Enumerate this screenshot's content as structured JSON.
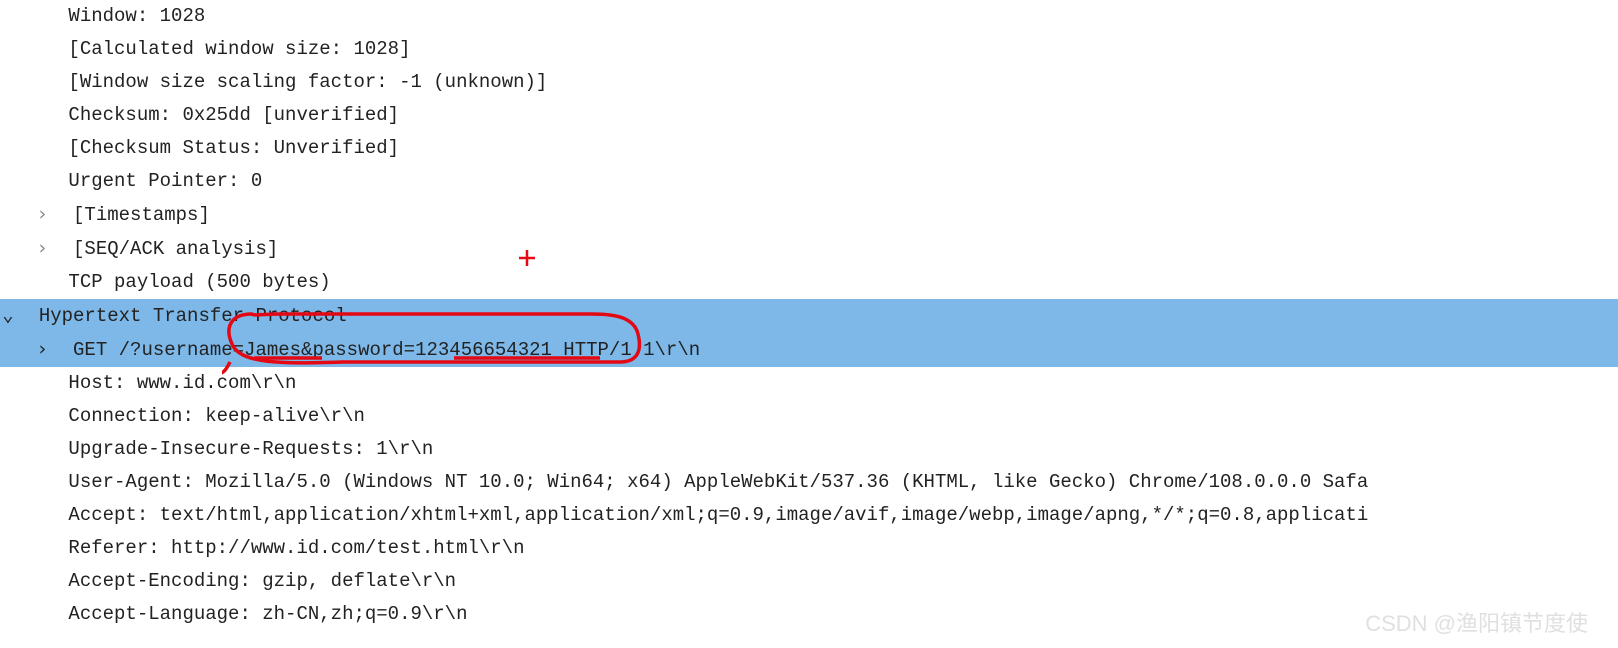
{
  "tcp": {
    "window": "Window: 1028",
    "calc_window": "[Calculated window size: 1028]",
    "scale_factor": "[Window size scaling factor: -1 (unknown)]",
    "checksum": "Checksum: 0x25dd [unverified]",
    "checksum_status": "[Checksum Status: Unverified]",
    "urgent_pointer": "Urgent Pointer: 0",
    "timestamps": "[Timestamps]",
    "seq_ack": "[SEQ/ACK analysis]",
    "payload": "TCP payload (500 bytes)"
  },
  "http": {
    "header": "Hypertext Transfer Protocol",
    "request_line": "GET /?username=James&password=123456654321 HTTP/1.1\\r\\n",
    "host": "Host: www.id.com\\r\\n",
    "connection": "Connection: keep-alive\\r\\n",
    "upgrade_insecure": "Upgrade-Insecure-Requests: 1\\r\\n",
    "user_agent": "User-Agent: Mozilla/5.0 (Windows NT 10.0; Win64; x64) AppleWebKit/537.36 (KHTML, like Gecko) Chrome/108.0.0.0 Safa",
    "accept": "Accept: text/html,application/xhtml+xml,application/xml;q=0.9,image/avif,image/webp,image/apng,*/*;q=0.8,applicati",
    "referer": "Referer: http://www.id.com/test.html\\r\\n",
    "accept_encoding": "Accept-Encoding: gzip, deflate\\r\\n",
    "accept_language": "Accept-Language: zh-CN,zh;q=0.9\\r\\n"
  },
  "watermark": "CSDN @渔阳镇节度使",
  "annotation": {
    "red_cross": "+",
    "username_value": "James",
    "password_value": "123456654321"
  }
}
